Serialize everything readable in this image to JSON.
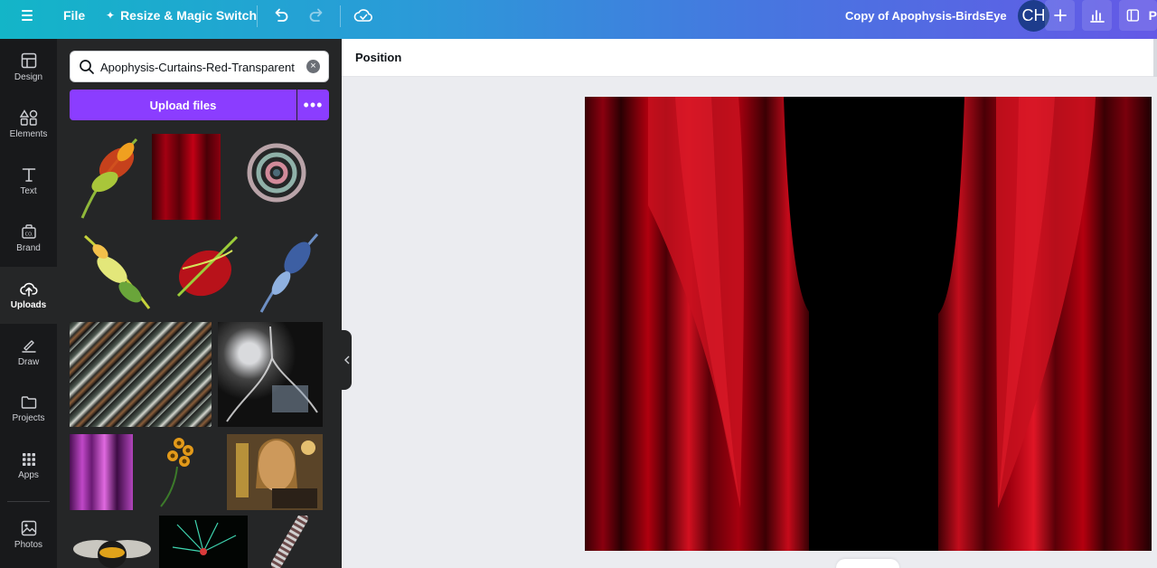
{
  "topbar": {
    "menu_icon": "hamburger-icon",
    "file_label": "File",
    "resize_label": "Resize & Magic Switch",
    "undo_icon": "undo-icon",
    "redo_icon": "redo-icon",
    "cloud_icon": "cloud-check-icon",
    "doc_title": "Copy of Apophysis-BirdsEye",
    "avatar_initials": "CH",
    "plus_icon": "plus-icon",
    "analytics_icon": "bar-chart-icon",
    "present_label": "P",
    "present_icon": "present-icon"
  },
  "rail": {
    "items": [
      {
        "label": "Design",
        "icon": "layout-icon"
      },
      {
        "label": "Elements",
        "icon": "shapes-icon"
      },
      {
        "label": "Text",
        "icon": "text-icon"
      },
      {
        "label": "Brand",
        "icon": "brand-kit-icon"
      },
      {
        "label": "Uploads",
        "icon": "cloud-upload-icon"
      },
      {
        "label": "Draw",
        "icon": "pen-icon"
      },
      {
        "label": "Projects",
        "icon": "folder-icon"
      },
      {
        "label": "Apps",
        "icon": "grid-icon"
      },
      {
        "label": "Photos",
        "icon": "image-icon"
      }
    ],
    "active": "Uploads"
  },
  "panel": {
    "search_value": "Apophysis-Curtains-Red-Transparent",
    "upload_label": "Upload files",
    "more_label": "•••",
    "thumbnails": [
      "fractal-flower-red-green",
      "red-curtain",
      "fractal-spiral-pastel",
      "fractal-leaf-yellow-green",
      "fractal-feather-red-green",
      "fractal-feather-blue",
      "diagonal-streaks",
      "dark-tree-collage",
      "purple-curtain",
      "orange-flower-dark",
      "steampunk-woman-collage",
      "bumblebee",
      "green-burst-dark",
      "striped-spiral"
    ]
  },
  "toolbar": {
    "position_label": "Position"
  },
  "colors": {
    "accent_purple": "#8b3dff",
    "rail_bg": "#18191b",
    "panel_bg": "#252627",
    "canvas_bg": "#ebecf0",
    "curtain_red": "#c8101e"
  }
}
